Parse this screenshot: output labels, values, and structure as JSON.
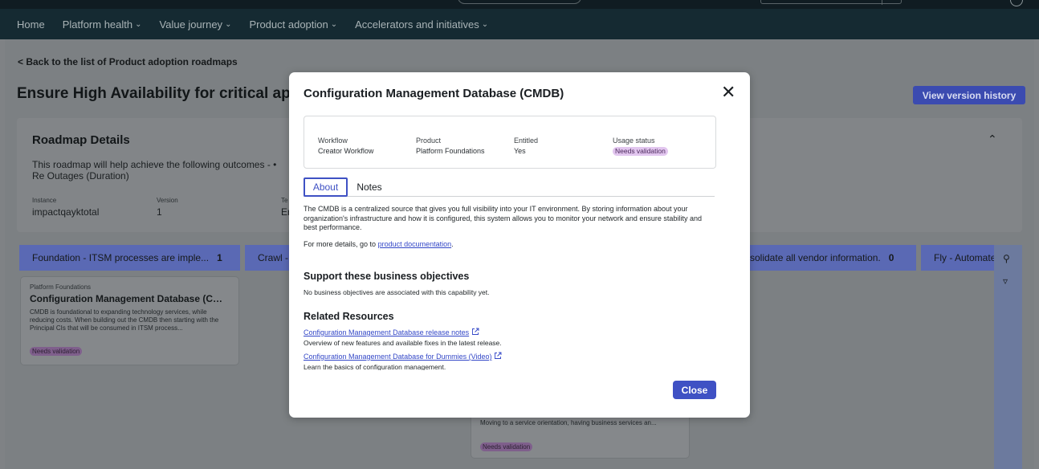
{
  "nav": {
    "items": [
      {
        "label": "Home",
        "has_menu": false
      },
      {
        "label": "Platform health",
        "has_menu": true
      },
      {
        "label": "Value journey",
        "has_menu": true
      },
      {
        "label": "Product adoption",
        "has_menu": true
      },
      {
        "label": "Accelerators and initiatives",
        "has_menu": true
      }
    ]
  },
  "page": {
    "back_link": "< Back to the list of Product adoption roadmaps",
    "title": "Ensure High Availability for critical appl",
    "version_history_button": "View version history"
  },
  "roadmap_details": {
    "heading": "Roadmap Details",
    "description": "This roadmap will help achieve the following outcomes - • Re Outages (Duration)",
    "instance_label": "Instance",
    "instance_value": "impactqayktotal",
    "version_label": "Version",
    "version_value": "1",
    "third_label": "Te",
    "third_value": "Er"
  },
  "lanes": [
    {
      "label": "Foundation - ITSM processes are imple...",
      "count": "1"
    },
    {
      "label": "Crawl -",
      "count": ""
    },
    {
      "label": "solidate all vendor information.",
      "count": "0"
    },
    {
      "label": "Fly - Automate",
      "count": ""
    }
  ],
  "bg_cards": [
    {
      "product": "Platform Foundations",
      "title": "Configuration Management Database (CMD...",
      "description": "CMDB is foundational to expanding technology services, while reducing costs. When building out the CMDB then starting with the Principal CIs that will be consumed in ITSM process...",
      "badge": "Needs validation"
    },
    {
      "product": "",
      "title": "",
      "description": "Moving to a service orientation, having business services an...",
      "badge": "Needs validation"
    }
  ],
  "modal": {
    "title": "Configuration Management Database (CMDB)",
    "info": {
      "workflow_label": "Workflow",
      "workflow_value": "Creator Workflow",
      "product_label": "Product",
      "product_value": "Platform Foundations",
      "entitled_label": "Entitled",
      "entitled_value": "Yes",
      "usage_label": "Usage status",
      "usage_value": "Needs validation"
    },
    "tabs": [
      {
        "label": "About",
        "active": true
      },
      {
        "label": "Notes",
        "active": false
      }
    ],
    "about_text": "The CMDB is a centralized source that gives you full visibility into your IT environment. By storing information about your organization's infrastructure and how it is configured, this system allows you to monitor your network and ensure stability and best performance.",
    "more_details_prefix": "For more details, go to",
    "more_details_link": "product documentation",
    "more_details_suffix": ".",
    "objectives_heading": "Support these business objectives",
    "objectives_text": "No business objectives are associated with this capability yet.",
    "resources_heading": "Related Resources",
    "resources": [
      {
        "link": "Configuration Management Database release notes",
        "description": "Overview of new features and available fixes in the latest release."
      },
      {
        "link": "Configuration Management Database for Dummies (Video)",
        "description": "Learn the basics of configuration management."
      }
    ],
    "close_button": "Close"
  },
  "colors": {
    "accent": "#3f51c4",
    "badge_bg": "#e2c6ef",
    "nav_bg": "#152a32"
  }
}
